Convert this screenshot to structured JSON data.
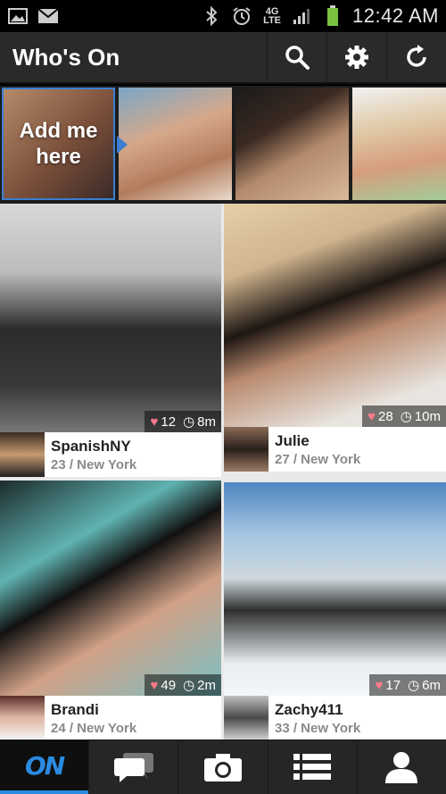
{
  "status_bar": {
    "time": "12:42 AM",
    "network": "4G LTE",
    "icons": [
      "gallery-icon",
      "gmail-icon",
      "bluetooth-icon",
      "alarm-icon",
      "4g-lte-icon",
      "signal-icon",
      "battery-icon"
    ]
  },
  "action_bar": {
    "title": "Who's On",
    "actions": [
      "search-icon",
      "settings-icon",
      "refresh-icon"
    ]
  },
  "strip": {
    "add_me_line1": "Add me",
    "add_me_line2": "here",
    "accent": "#3a7fd0"
  },
  "profiles": [
    {
      "name": "SpanishNY",
      "age_location": "23 / New York",
      "likes": "12",
      "time": "8m"
    },
    {
      "name": "Julie",
      "age_location": "27 / New York",
      "likes": "28",
      "time": "10m"
    },
    {
      "name": "Brandi",
      "age_location": "24 / New York",
      "likes": "49",
      "time": "2m"
    },
    {
      "name": "Zachy411",
      "age_location": "33 / New York",
      "likes": "17",
      "time": "6m"
    }
  ],
  "bottom_nav": {
    "logo": "ON",
    "items": [
      "on-home-icon",
      "chat-icon",
      "camera-icon",
      "list-icon",
      "profile-icon"
    ],
    "accent": "#2a8be0"
  }
}
